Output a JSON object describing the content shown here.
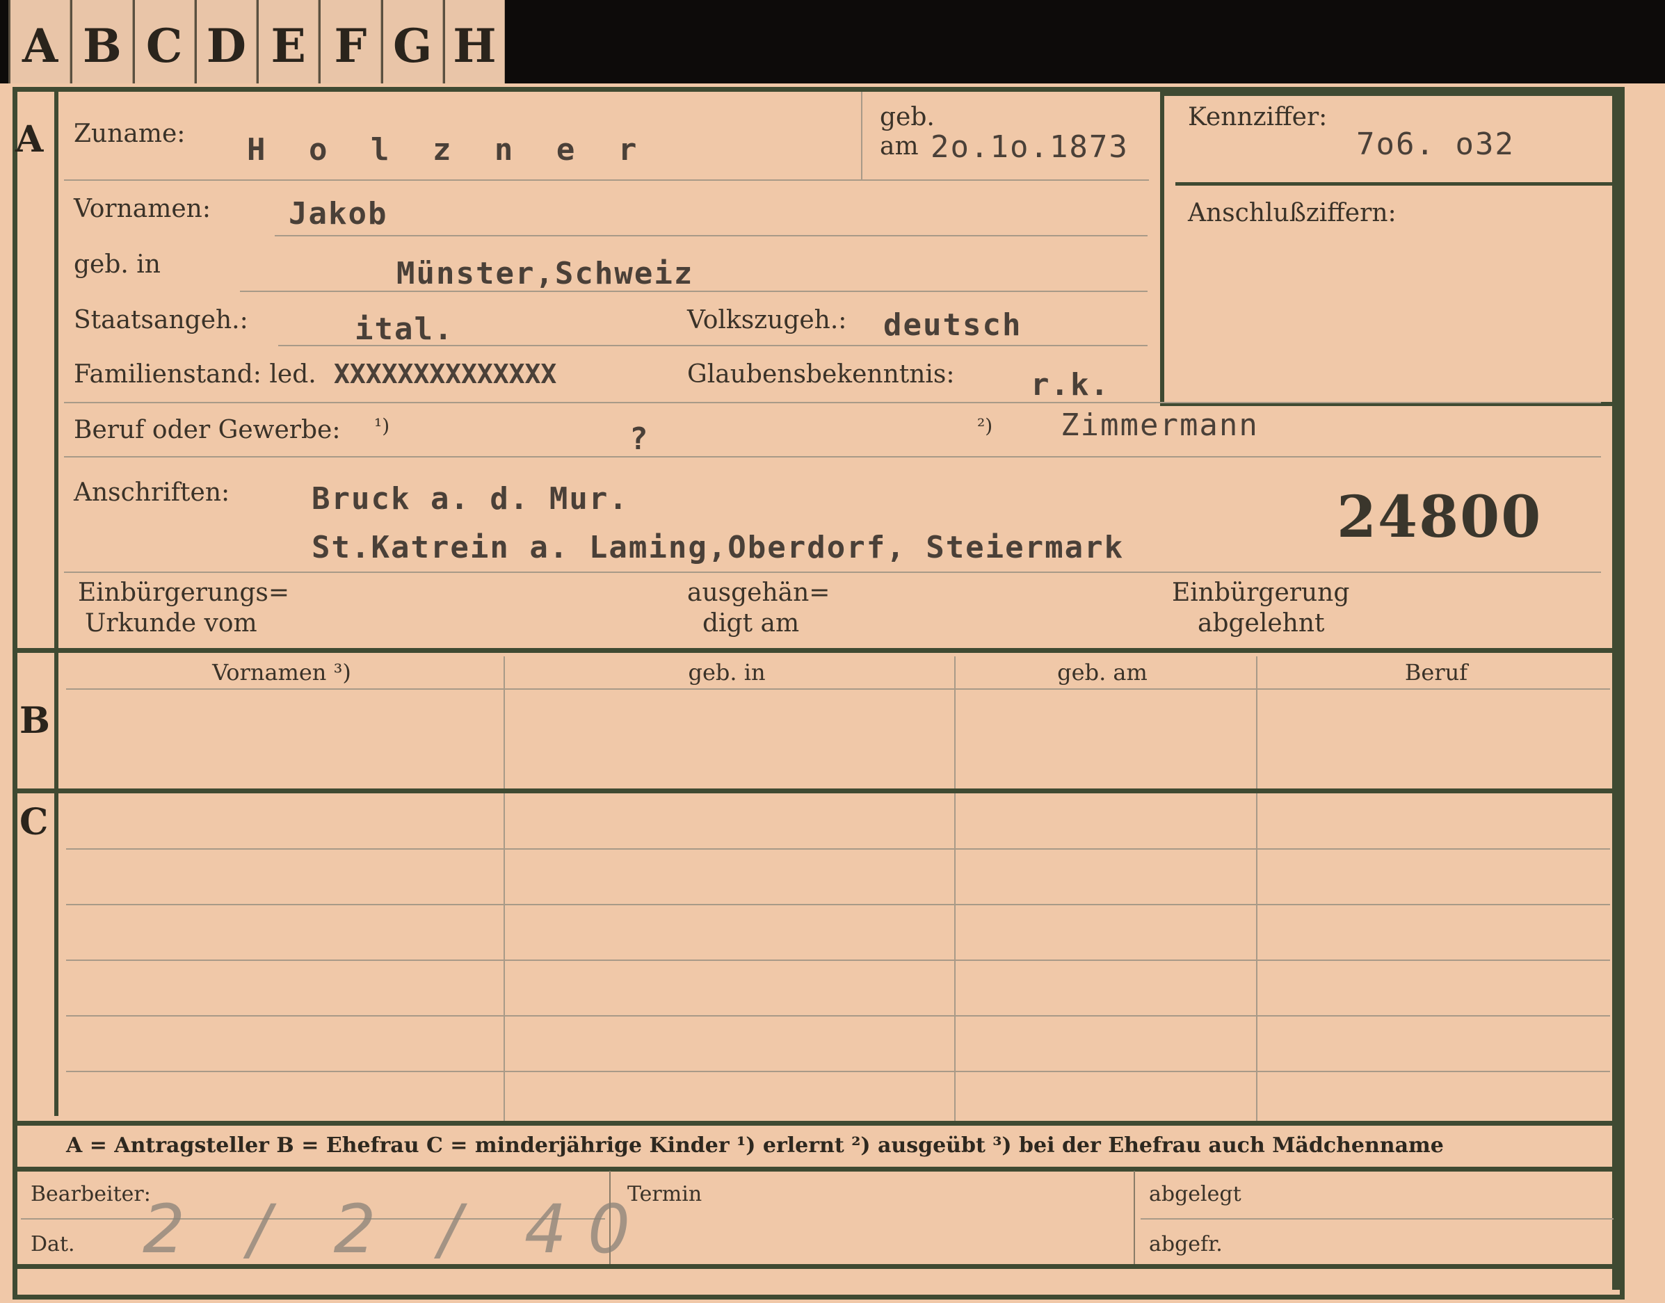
{
  "tabs": [
    "A",
    "B",
    "C",
    "D",
    "E",
    "F",
    "G",
    "H"
  ],
  "sections": {
    "a": "A",
    "b": "B",
    "c": "C"
  },
  "labels": {
    "zuname": "Zuname:",
    "geb": "geb.",
    "geb_am": "am",
    "kennziffer": "Kennziffer:",
    "anschluss": "Anschlußziffern:",
    "vornamen": "Vornamen:",
    "geb_in": "geb. in",
    "staatsangeh": "Staatsangeh.:",
    "volkszugeh": "Volkszugeh.:",
    "familienstand": "Familienstand: led.",
    "glaubens": "Glaubensbekenntnis:",
    "beruf": "Beruf oder Gewerbe:",
    "beruf_note1": "¹)",
    "beruf_note2": "²)",
    "anschriften": "Anschriften:",
    "einb_urkunde_1": "Einbürgerungs=",
    "einb_urkunde_2": "Urkunde vom",
    "ausgeh_1": "ausgehän=",
    "ausgeh_2": "digt am",
    "einb_abgelehnt_1": "Einbürgerung",
    "einb_abgelehnt_2": "abgelehnt"
  },
  "values": {
    "zuname": "H o l z n e r",
    "geb_datum": "2o.1o.1873",
    "kennziffer": "7o6. o32",
    "vornamen": "Jakob",
    "geburtsort": "Münster,Schweiz",
    "staatsangehoerigkeit": "ital.",
    "volkszugehoerigkeit": "deutsch",
    "familienstand_struck": "XXXXXXXXXXXXXX",
    "glaube": "r.k.",
    "beruf_erlernt": "?",
    "beruf_ausgeuebt": "Zimmermann",
    "anschrift_1": "Bruck a. d. Mur.",
    "anschrift_2": "St.Katrein a. Laming,Oberdorf, Steiermark",
    "stamp_number": "24800"
  },
  "table": {
    "headers": [
      "Vornamen ³)",
      "geb. in",
      "geb. am",
      "Beruf"
    ]
  },
  "legend": "A = Antragsteller   B = Ehefrau   C = minderjährige Kinder   ¹) erlernt   ²) ausgeübt   ³) bei der Ehefrau auch Mädchenname",
  "footer": {
    "bearbeiter": "Bearbeiter:",
    "dat": "Dat.",
    "dat_handwritten": "2 / 2 / 40",
    "termin": "Termin",
    "abgelegt": "abgelegt",
    "abgefr": "abgefr."
  },
  "colors": {
    "card": "#f0c8a8",
    "frame": "#3f4a32",
    "background": "#0d0b0a"
  }
}
